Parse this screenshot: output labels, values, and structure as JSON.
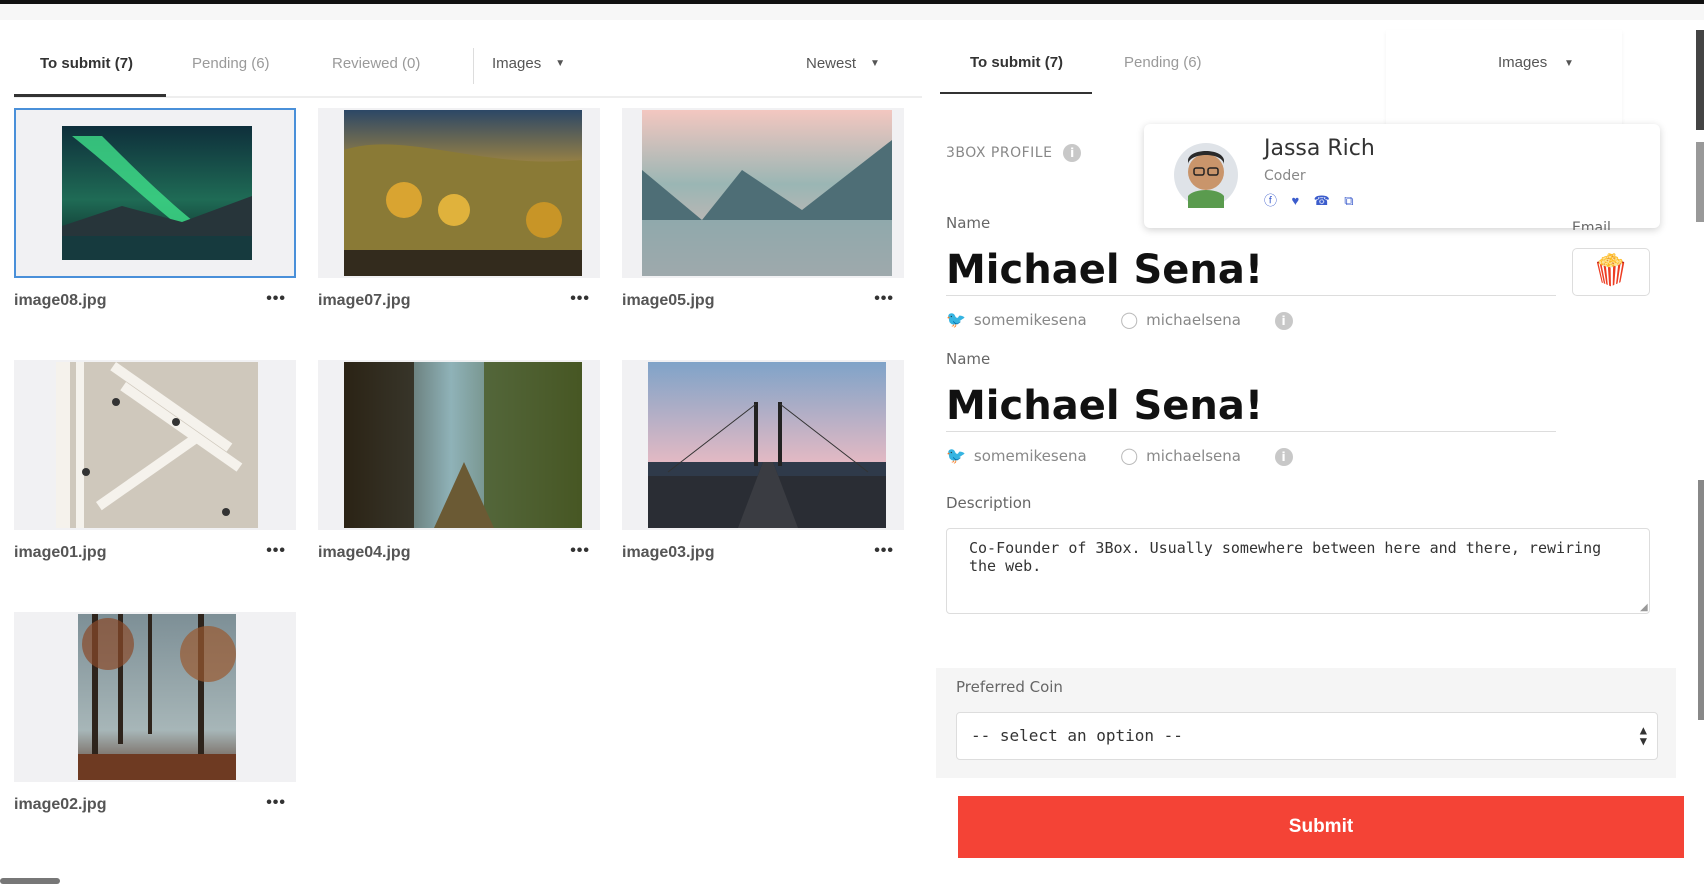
{
  "gallery": {
    "tabs": [
      {
        "label": "To submit (7)"
      },
      {
        "label": "Pending (6)"
      },
      {
        "label": "Reviewed (0)"
      }
    ],
    "filter_label": "Images",
    "sort_label": "Newest",
    "more_glyph": "•••",
    "images": [
      {
        "name": "image08.jpg",
        "selected": true
      },
      {
        "name": "image07.jpg"
      },
      {
        "name": "image05.jpg"
      },
      {
        "name": "image01.jpg"
      },
      {
        "name": "image04.jpg"
      },
      {
        "name": "image03.jpg"
      },
      {
        "name": "image02.jpg"
      }
    ]
  },
  "panel": {
    "tabs": [
      {
        "label": "To submit (7)"
      },
      {
        "label": "Pending (6)"
      }
    ],
    "filter_label": "Images",
    "profile_section_label": "3BOX PROFILE",
    "profile_card": {
      "name": "Jassa Rich",
      "role": "Coder",
      "social_icons": [
        "facebook-icon",
        "twitter-icon",
        "phone-icon",
        "link-icon"
      ]
    },
    "name_label": "Name",
    "email_label": "Email",
    "name_blocks": [
      {
        "label": "Name",
        "value": "Michael Sena!",
        "twitter": "somemikesena",
        "github": "michaelsena"
      },
      {
        "label": "Name",
        "value": "Michael Sena!",
        "twitter": "somemikesena",
        "github": "michaelsena"
      }
    ],
    "emoji": "🍿",
    "description_label": "Description",
    "description": "Co-Founder of 3Box. Usually somewhere between here and there, rewiring the web.",
    "coin_label": "Preferred Coin",
    "coin_selected": "-- select an option --",
    "submit_label": "Submit"
  },
  "colors": {
    "selection_border": "#4a90d9",
    "submit_bg": "#f44336",
    "social_blue": "#3b5ccc"
  }
}
